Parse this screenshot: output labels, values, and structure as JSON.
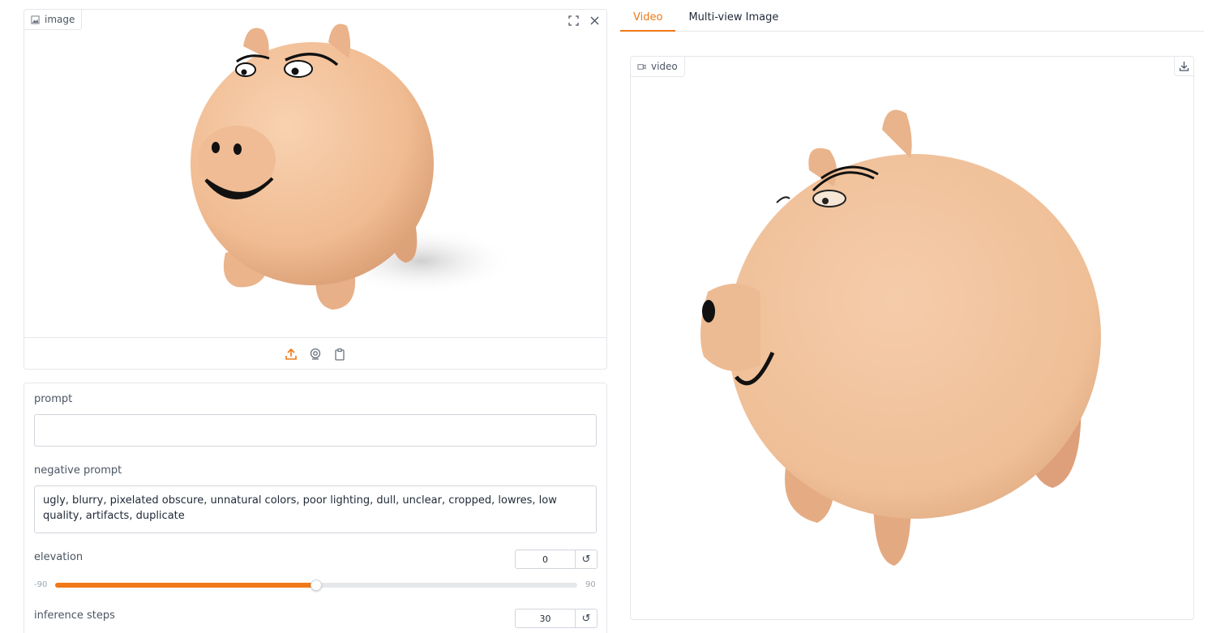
{
  "input_image": {
    "label": "image",
    "icon": "image-icon"
  },
  "toolbar": {
    "fullscreen_icon": "fullscreen-icon",
    "close_icon": "close-icon"
  },
  "sources": [
    "upload-icon",
    "webcam-icon",
    "clipboard-icon"
  ],
  "form": {
    "prompt": {
      "label": "prompt",
      "value": ""
    },
    "negative_prompt": {
      "label": "negative prompt",
      "value": "ugly, blurry, pixelated obscure, unnatural colors, poor lighting, dull, unclear, cropped, lowres, low quality, artifacts, duplicate"
    },
    "elevation": {
      "label": "elevation",
      "value": "0",
      "min": "-90",
      "max": "90",
      "fraction": 0.5
    },
    "inference_steps": {
      "label": "inference steps",
      "value": "30"
    }
  },
  "tabs": [
    {
      "label": "Video",
      "active": true
    },
    {
      "label": "Multi-view Image",
      "active": false
    }
  ],
  "output_video": {
    "label": "video",
    "icon": "video-icon",
    "download_icon": "download-icon"
  },
  "colors": {
    "accent": "#f07817",
    "pig_skin": "#f2c29b",
    "border": "#e5e7eb"
  }
}
